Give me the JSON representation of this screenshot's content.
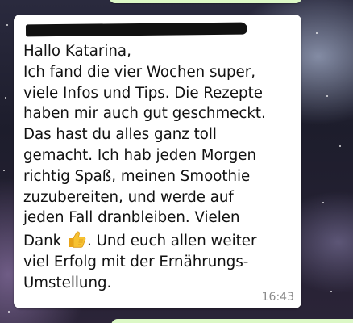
{
  "message": {
    "line1": "Hallo Katarina,\nIch fand die vier Wochen super,\nviele Infos und Tips. Die Rezepte\nhaben mir auch gut geschmeckt.\nDas hast du alles ganz toll\ngemacht. Ich hab jeden Morgen\nrichtig Spaß, meinen Smoothie\nzuzubereiten, und werde auf\njeden Fall dranbleiben. Vielen\nDank ",
    "emoji": "thumbs-up-icon",
    "line2": ". Und euch allen weiter\nviel Erfolg mit der Ernährungs-\nUmstellung.",
    "time": "16:43"
  },
  "colors": {
    "incoming_bubble": "#ffffff",
    "outgoing_bubble": "#dcf8c6",
    "timestamp": "#8a8a8a"
  }
}
